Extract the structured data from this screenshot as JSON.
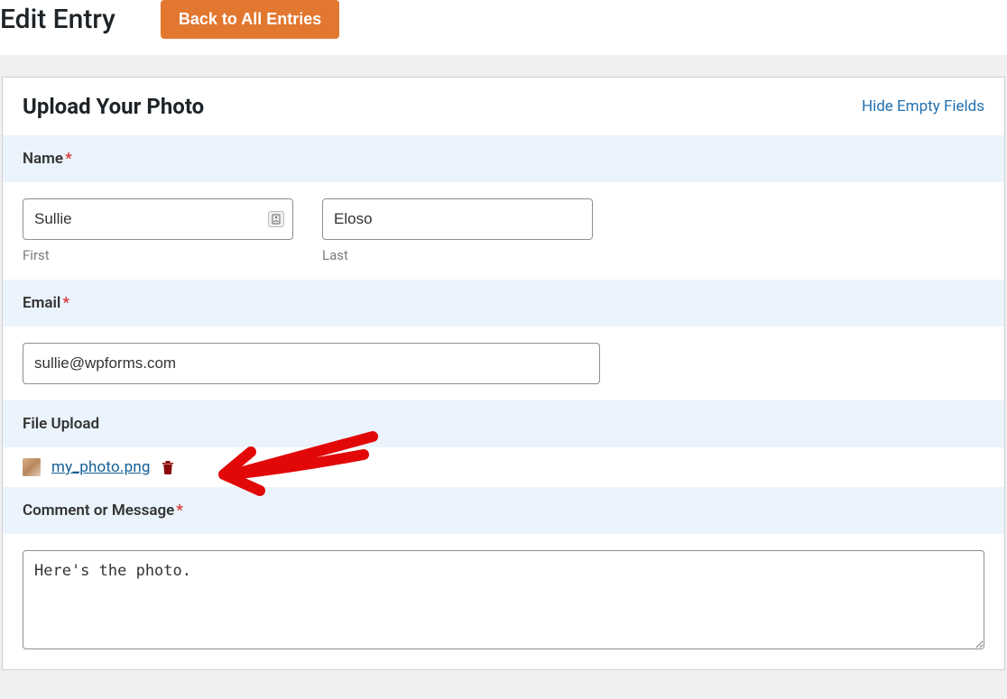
{
  "header": {
    "title": "Edit Entry",
    "back_button": "Back to All Entries"
  },
  "entry": {
    "form_title": "Upload Your Photo",
    "hide_fields_link": "Hide Empty Fields"
  },
  "fields": {
    "name": {
      "label": "Name",
      "first_value": "Sullie",
      "first_sublabel": "First",
      "last_value": "Eloso",
      "last_sublabel": "Last"
    },
    "email": {
      "label": "Email",
      "value": "sullie@wpforms.com"
    },
    "file": {
      "label": "File Upload",
      "filename": "my_photo.png"
    },
    "comment": {
      "label": "Comment or Message",
      "value": "Here's the photo."
    }
  }
}
